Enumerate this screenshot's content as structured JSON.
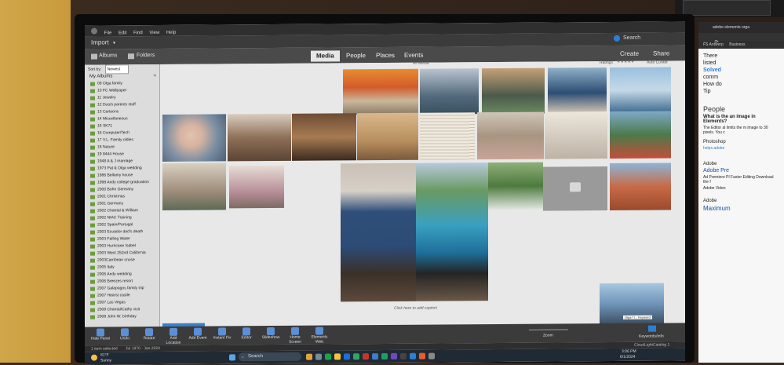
{
  "app": {
    "import_label": "Import",
    "menus": [
      "File",
      "Edit",
      "Find",
      "View",
      "Help"
    ],
    "search_label": "Search",
    "view_tabs": [
      {
        "label": "Media",
        "active": true
      },
      {
        "label": "People",
        "active": false
      },
      {
        "label": "Places",
        "active": false
      },
      {
        "label": "Events",
        "active": false
      }
    ],
    "create_label": "Create",
    "share_label": "Share"
  },
  "sidebar": {
    "tabs": {
      "albums": "Albums",
      "folders": "Folders"
    },
    "sort_label": "Sort by:",
    "sort_value": "Newest",
    "media_label": "All Media",
    "my_albums_label": "My Albums",
    "albums": [
      "09 Olga family",
      "10 FC Wallpaper",
      "11 Jewelry",
      "12 Dutch parents stuff",
      "13 Cartoons",
      "14 Miscellaneous",
      "15 SK71",
      "16 Computer/Tech",
      "17 V.L. Family oldies",
      "18 Nature",
      "19 8444 House",
      "1948 A & J marriage",
      "1973 Pat & Olga wedding",
      "1986 Bellamy house",
      "1998 Andy college graduation",
      "2000 Bohn Germany",
      "2001 Christmas",
      "2001 Germany",
      "2002 Chantal & William",
      "2002 NIAC Training",
      "2002 Spain/Portugal",
      "2003 Ecuador dad's death",
      "2003 Falling Water",
      "2003 Hurricane Isabel",
      "2003 West 252nd California",
      "2003Carribean cruise",
      "2005 Italy",
      "2006 Andy wedding",
      "2006 Breezes resort",
      "2007 Galapagos family trip",
      "2007 Hearst castle",
      "2007 Las Vegas",
      "2008 Chantal/Cathy visit",
      "2008 John W. birthday"
    ]
  },
  "main": {
    "ratings_label": "Ratings",
    "auto_curate_label": "Auto Curate",
    "caption_prompt": "Click here to add caption",
    "tooltip_text": "Olga f l... Keyword"
  },
  "bottom": {
    "buttons": [
      "Hide Panel",
      "Undo",
      "Rotate",
      "Add Location",
      "Add Event",
      "Instant Fix",
      "Editor",
      "Slideshow",
      "Home Screen",
      "Elements Web"
    ],
    "zoom_label": "Zoom",
    "keywords_label": "Keywords/Info",
    "status_selected": "1 item selected",
    "status_dates": "Jul 1970 - Jan 2024",
    "catalog": "CloudLightCatalog 1"
  },
  "taskbar": {
    "weather_temp": "81°F",
    "weather_desc": "Sunny",
    "search": "Search",
    "time": "3:06 PM",
    "date": "6/1/2024"
  },
  "right_monitor": {
    "tab_title": "adobe elements orga",
    "bookmarks": [
      "FS Antwerp",
      "Business"
    ],
    "snippets": [
      "There",
      "listed",
      "Solved",
      "comm",
      "How do",
      "Tip"
    ],
    "people_heading": "People",
    "question": "What is the an image in Elements?",
    "answer": "The Editor al limits the m image to 30 pixels. You c",
    "photoshop_label": "Photoshop",
    "photoshop_url": "helpx.adobe",
    "adobe1": "Adobe",
    "adobe_pre": "Adobe Pre",
    "adobe_pre_desc": "Ad Premiere Pl Faster Editing Download the f",
    "adobe_video": "Adobe Video",
    "adobe2": "Adobe",
    "maximum": "Maximum"
  },
  "colors": {
    "toolbar": "#3b3b3b",
    "active_tab": "#e6e6e6",
    "album_icon": "#6b9c3c",
    "accent_blue": "#2d7fd3"
  }
}
